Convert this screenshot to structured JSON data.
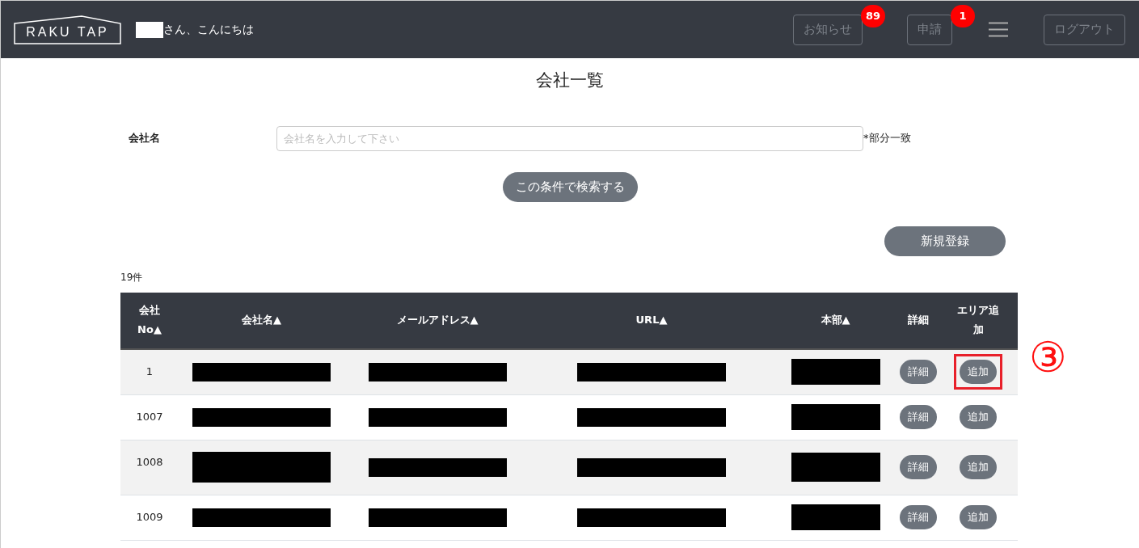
{
  "header": {
    "logo": "RAKU TAP",
    "greeting": "さん、こんにちは",
    "buttons": [
      {
        "label": "お知らせ",
        "badge": "89"
      },
      {
        "label": "申請",
        "badge": "1"
      }
    ],
    "logout": "ログアウト"
  },
  "title": "会社一覧",
  "search": {
    "label": "会社名",
    "placeholder": "会社名を入力して下さい",
    "note": "*部分一致",
    "button": "この条件で検索する"
  },
  "new_button": "新規登録",
  "count": "19件",
  "table": {
    "columns": [
      {
        "label": "会社No",
        "sort": "▲"
      },
      {
        "label": "会社名",
        "sort": "▲"
      },
      {
        "label": "メールアドレス",
        "sort": "▲"
      },
      {
        "label": "URL",
        "sort": "▲"
      },
      {
        "label": "本部",
        "sort": "▲"
      },
      {
        "label": "詳細"
      },
      {
        "label": "エリア追加"
      }
    ],
    "rows": [
      {
        "no": "1",
        "detail": "詳細",
        "add": "追加",
        "highlighted": true
      },
      {
        "no": "1007",
        "detail": "詳細",
        "add": "追加",
        "highlighted": false
      },
      {
        "no": "1008",
        "detail": "詳細",
        "add": "追加",
        "highlighted": false
      },
      {
        "no": "1009",
        "detail": "詳細",
        "add": "追加",
        "highlighted": false
      }
    ]
  },
  "annotation": "③"
}
